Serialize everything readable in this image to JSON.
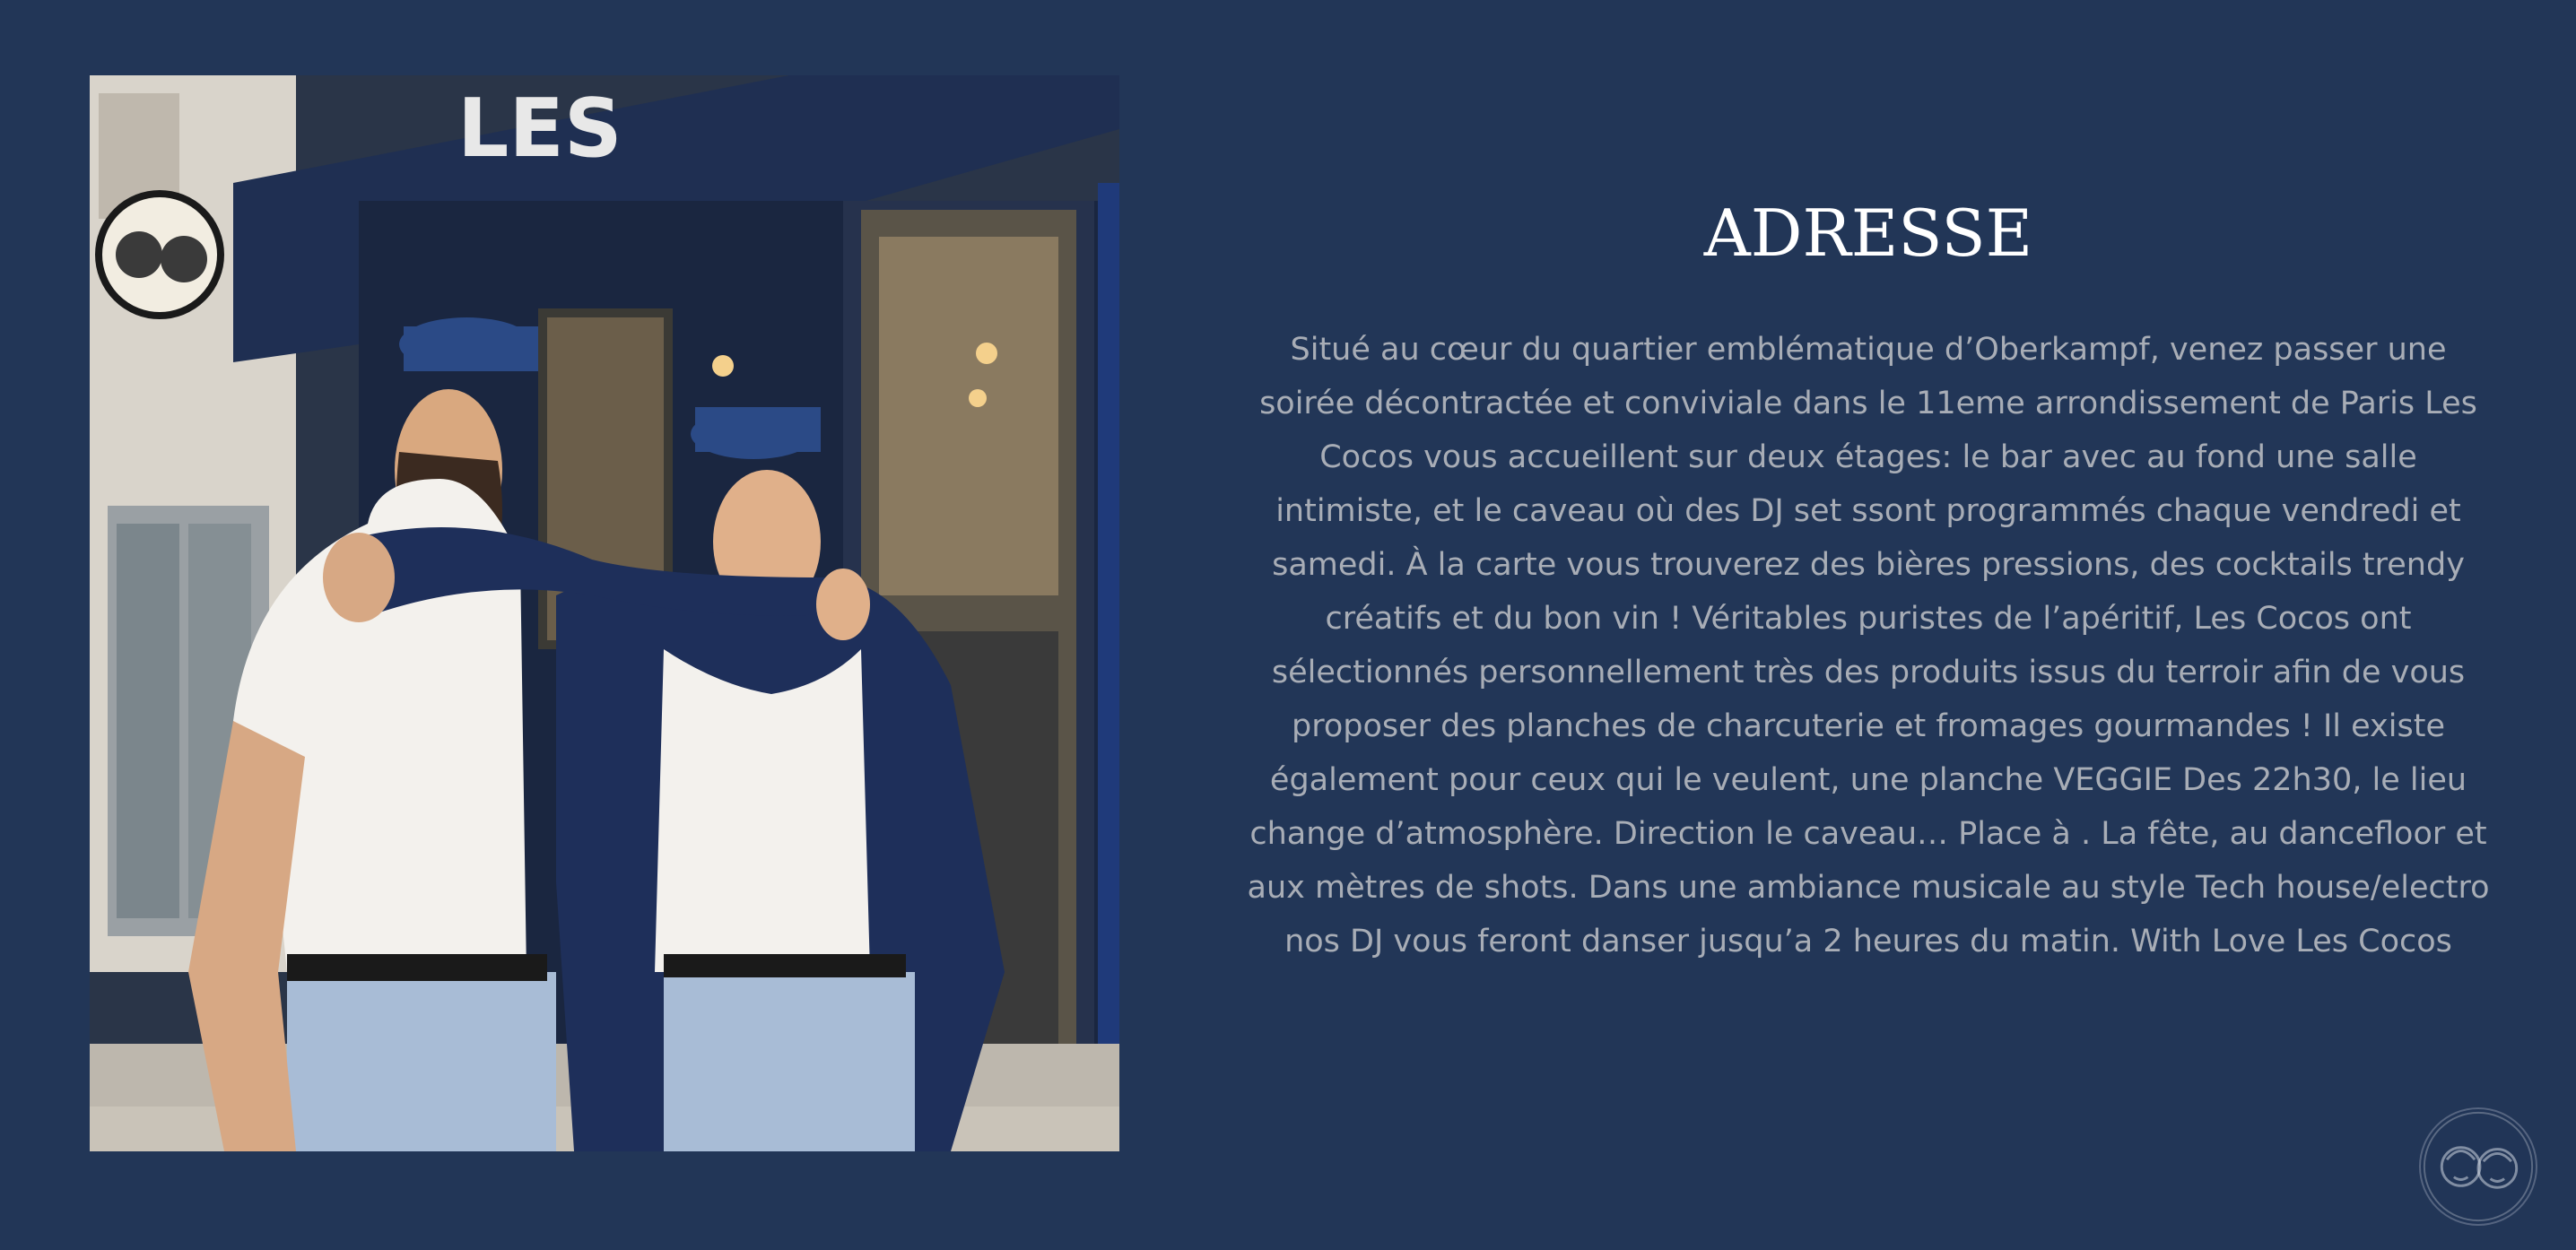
{
  "section": {
    "title": "ADRESSE",
    "description": "Situé au cœur du quartier emblématique  d’Oberkampf, venez passer une soirée décontractée et conviviale dans le 11eme arrondissement de Paris Les Cocos vous accueillent sur deux étages: le bar avec au fond une salle intimiste, et le caveau où des DJ set ssont programmés chaque vendredi et samedi. À la carte vous trouverez des bières pressions, des cocktails trendy créatifs et du bon vin ! Véritables puristes de l’apéritif, Les Cocos ont sélectionnés personnellement très des produits issus du terroir afin de vous proposer des planches de charcuterie et fromages gourmandes ! Il existe également pour ceux qui le veulent, une planche VEGGIE Des 22h30, le lieu change d’atmosphère. Direction le caveau… Place à . La fête, au dancefloor et aux mètres de shots. Dans une ambiance musicale au style Tech house/electro nos  DJ vous feront danser jusqu’a 2 heures du matin. With Love Les Cocos"
  },
  "photo": {
    "icon": "founders-photo",
    "storefront_sign": "LES"
  },
  "badge": {
    "icon": "les-cocos-logo-icon"
  },
  "colors": {
    "background": "#223657",
    "title": "#ffffff",
    "body_text": "#a8adb6"
  }
}
